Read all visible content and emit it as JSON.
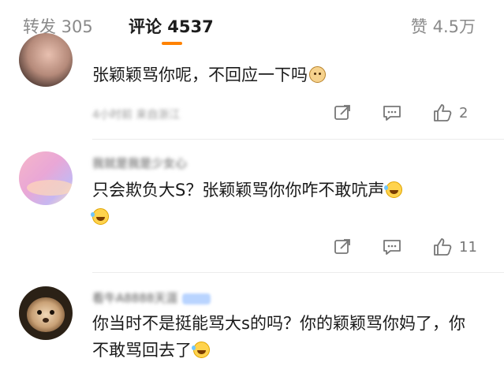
{
  "tabs": {
    "repost": "转发 305",
    "comments": "评论 4537",
    "likes": "赞 4.5万",
    "accent_color": "#ff8200"
  },
  "comments": [
    {
      "text": "张颖颖骂你呢，不回应一下吗",
      "emoji": "dog-face-emoji",
      "meta": "4小时前  来自浙江",
      "likes": "2",
      "icons": [
        "share-icon",
        "reply-icon",
        "thumbs-up-icon"
      ]
    },
    {
      "username": "我就是我是少女心",
      "text": "只会欺负大S？张颖颖骂你你咋不敢吭声",
      "emoji": "laugh-cry-emoji",
      "likes": "11",
      "icons": [
        "share-icon",
        "reply-icon",
        "thumbs-up-icon"
      ]
    },
    {
      "username": "看牛A8888天涯",
      "text": "你当时不是挺能骂大s的吗？你的颖颖骂你妈了，你不敢骂回去了",
      "emoji": "laugh-cry-emoji"
    }
  ]
}
